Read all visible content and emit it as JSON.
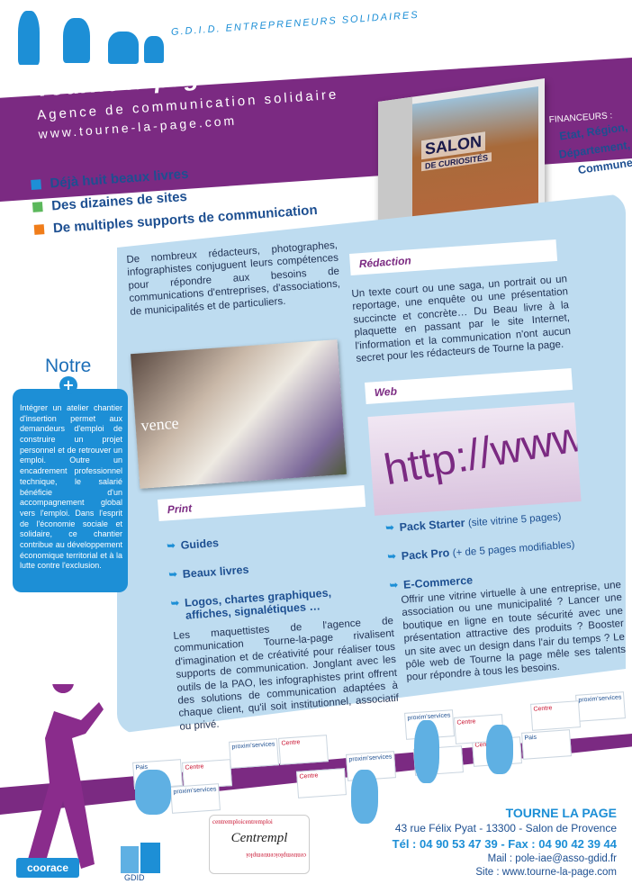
{
  "header": {
    "org": "G.D.I.D. ENTREPRENEURS SOLIDAIRES",
    "title": "Tourne la page",
    "subtitle": "Agence de communication solidaire",
    "url": "www.tourne-la-page.com"
  },
  "financeurs": {
    "label": "FINANCEURS :",
    "items": [
      "Etat, Région,",
      "Département,",
      "Commune"
    ]
  },
  "book": {
    "title": "SALON",
    "subtitle": "DE CURIOSITÉS"
  },
  "bullets": [
    {
      "label": "Déjà huit beaux livres",
      "color": "#1d8fd6"
    },
    {
      "label": "Des dizaines de sites",
      "color": "#5cb85c"
    },
    {
      "label": "De multiples supports de communication",
      "color": "#f07d1a"
    }
  ],
  "intro": "De nombreux rédacteurs, photographes, infographistes conjuguent leurs compétences pour répondre aux besoins de communications d'entreprises, d'associations, de municipalités et de particuliers.",
  "redaction": {
    "tag": "Rédaction",
    "text": "Un texte court ou une saga, un portrait ou un reportage, une enquête ou une présentation succincte et concrète… Du Beau livre à la plaquette en passant par le site Internet, l'information et la communication n'ont aucun secret pour les rédacteurs de Tourne la page."
  },
  "photo_text": "vence",
  "web": {
    "tag": "Web",
    "image_text": "http://www",
    "items": [
      {
        "label": "Pack Starter",
        "detail": "(site vitrine 5 pages)"
      },
      {
        "label": "Pack Pro",
        "detail": "(+ de 5 pages modifiables)"
      },
      {
        "label": "E-Commerce",
        "detail": ""
      }
    ],
    "text": "Offrir une vitrine virtuelle à une entreprise, une association ou une municipalité ? Lancer une boutique en ligne en toute sécurité avec une présentation attractive des produits ? Booster un site avec un design dans l'air du temps ? Le pôle web de Tourne la page mêle ses talents pour répondre à tous les besoins."
  },
  "print": {
    "tag": "Print",
    "items": [
      "Guides",
      "Beaux livres",
      "Logos, chartes graphiques, affiches, signalétiques …"
    ],
    "text": "Les maquettistes de l'agence de communication Tourne-la-page rivalisent d'imagination et de créativité pour réaliser tous supports de communication. Jonglant avec les outils de la PAO, les infographistes print offrent des solutions de communication adaptées à chaque client, qu'il soit institutionnel, associatif ou privé."
  },
  "notre": {
    "title": "Notre",
    "plus": "+",
    "text": "Intégrer un atelier chantier d'insertion permet aux demandeurs d'emploi de construire un projet personnel et de retrouver un emploi. Outre un encadrement professionnel technique, le salarié bénéficie d'un accompagnement global vers l'emploi. Dans l'esprit de l'économie sociale et solidaire, ce chantier contribue au développement économique territorial et à la lutte contre l'exclusion."
  },
  "logos": {
    "proxim": "proxim'services",
    "pais": "Pais",
    "centre": "Centre"
  },
  "contact": {
    "name": "TOURNE LA PAGE",
    "address": "43 rue Félix Pyat  - 13300 - Salon de Provence",
    "tel": "Tél : 04 90 53 47 39 - Fax : 04 90 42 39 44",
    "mail": "Mail : pole-iae@asso-gdid.fr",
    "site": "Site : www.tourne-la-page.com"
  },
  "footer_logos": {
    "centre_top": "centremploicentremploi",
    "centre_sig": "Centrempl",
    "centre_bottom": "centremploicentremploi",
    "coorace": "coorace",
    "gdid": "GDID"
  }
}
